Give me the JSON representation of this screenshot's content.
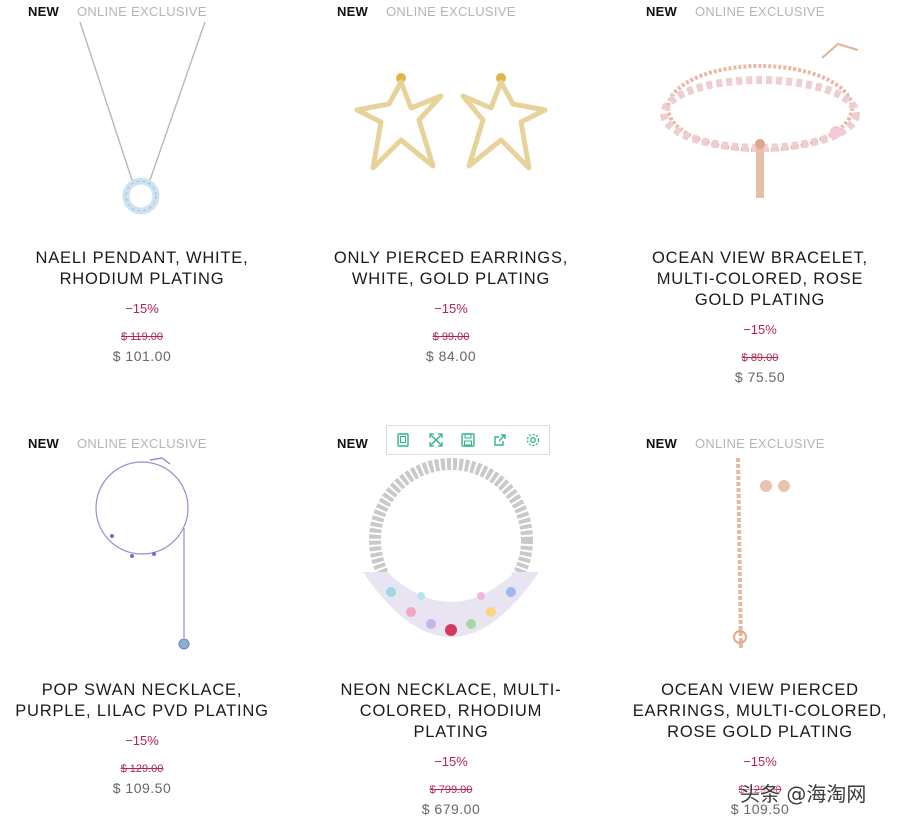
{
  "products": [
    {
      "badge_new": "NEW",
      "badge_exclusive": "ONLINE EXCLUSIVE",
      "name": [
        "NAELI PENDANT, WHITE,",
        "RHODIUM PLATING"
      ],
      "discount": "−15%",
      "old_price": "$ 119.00",
      "price": "$ 101.00"
    },
    {
      "badge_new": "NEW",
      "badge_exclusive": "ONLINE EXCLUSIVE",
      "name": [
        "ONLY PIERCED EARRINGS,",
        "WHITE, GOLD PLATING"
      ],
      "discount": "−15%",
      "old_price": "$ 99.00",
      "price": "$ 84.00"
    },
    {
      "badge_new": "NEW",
      "badge_exclusive": "ONLINE EXCLUSIVE",
      "name": [
        "OCEAN VIEW BRACELET,",
        "MULTI-COLORED, ROSE",
        "GOLD PLATING"
      ],
      "discount": "−15%",
      "old_price": "$ 89.00",
      "price": "$ 75.50"
    },
    {
      "badge_new": "NEW",
      "badge_exclusive": "ONLINE EXCLUSIVE",
      "name": [
        "POP SWAN NECKLACE,",
        "PURPLE, LILAC PVD PLATING"
      ],
      "discount": "−15%",
      "old_price": "$ 129.00",
      "price": "$ 109.50"
    },
    {
      "badge_new": "NEW",
      "badge_exclusive": "",
      "name": [
        "NEON NECKLACE, MULTI-",
        "COLORED, RHODIUM",
        "PLATING"
      ],
      "discount": "−15%",
      "old_price": "$ 799.00",
      "price": "$ 679.00"
    },
    {
      "badge_new": "NEW",
      "badge_exclusive": "ONLINE EXCLUSIVE",
      "name": [
        "OCEAN VIEW PIERCED",
        "EARRINGS, MULTI-COLORED,",
        "ROSE GOLD PLATING"
      ],
      "discount": "−15%",
      "old_price": "$ 129.00",
      "price": "$ 109.50"
    }
  ],
  "toolbar": {
    "icons": [
      "copy-icon",
      "expand-icon",
      "save-icon",
      "share-icon",
      "gear-icon"
    ],
    "color": "#2bb58a"
  },
  "watermark": "头条 @海淘网",
  "colors": {
    "discount": "#b1264a",
    "price": "#666666",
    "badge_exclusive": "#b5b5b5"
  }
}
